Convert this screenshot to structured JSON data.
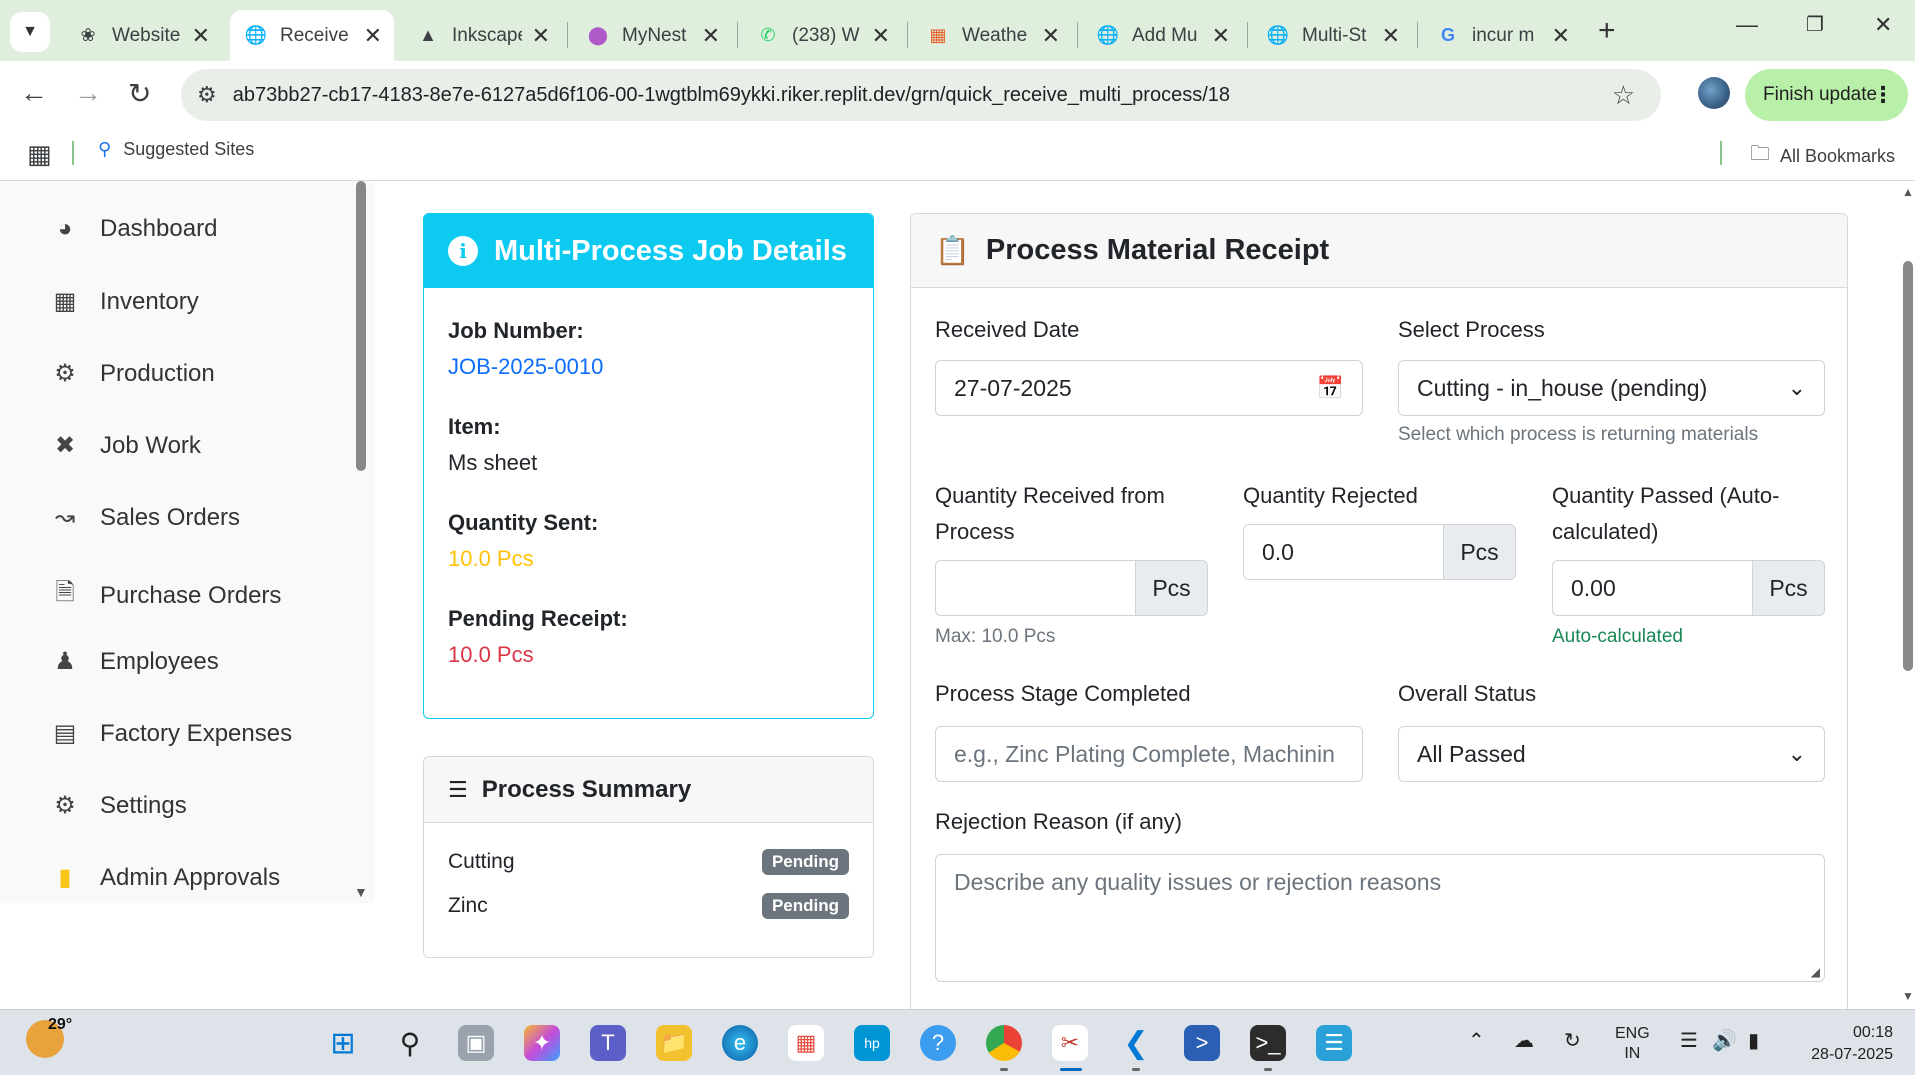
{
  "browser": {
    "tabs": [
      {
        "title": "Website",
        "icon": "openai-icon"
      },
      {
        "title": "Receive",
        "icon": "globe-icon",
        "active": true
      },
      {
        "title": "Inkscape",
        "icon": "inkscape-icon"
      },
      {
        "title": "MyNest",
        "icon": "mynest-icon"
      },
      {
        "title": "(238) W",
        "icon": "whatsapp-icon"
      },
      {
        "title": "Weathe",
        "icon": "weather-icon"
      },
      {
        "title": "Add Mu",
        "icon": "globe-icon"
      },
      {
        "title": "Multi-St",
        "icon": "globe-icon"
      },
      {
        "title": "incur m",
        "icon": "google-icon"
      }
    ],
    "url": "ab73bb27-cb17-4183-8e7e-6127a5d6f106-00-1wgtblm69ykki.riker.replit.dev/grn/quick_receive_multi_process/18",
    "finish_update": "Finish update",
    "bookmarks": {
      "suggested": "Suggested Sites",
      "all": "All Bookmarks"
    }
  },
  "sidebar": {
    "items": [
      {
        "label": "Dashboard",
        "icon": "dashboard-icon"
      },
      {
        "label": "Inventory",
        "icon": "boxes-icon"
      },
      {
        "label": "Production",
        "icon": "cogs-icon"
      },
      {
        "label": "Job Work",
        "icon": "tools-icon"
      },
      {
        "label": "Sales Orders",
        "icon": "chart-line-icon"
      },
      {
        "label": "Purchase Orders",
        "icon": "file-icon"
      },
      {
        "label": "Employees",
        "icon": "users-icon"
      },
      {
        "label": "Factory Expenses",
        "icon": "receipt-icon"
      },
      {
        "label": "Settings",
        "icon": "gear-icon"
      },
      {
        "label": "Admin Approvals",
        "icon": "clipboard-check-icon"
      }
    ]
  },
  "job_details": {
    "title": "Multi-Process Job Details",
    "job_number_label": "Job Number:",
    "job_number": "JOB-2025-0010",
    "item_label": "Item:",
    "item": "Ms sheet",
    "qty_sent_label": "Quantity Sent:",
    "qty_sent": "10.0 Pcs",
    "pending_label": "Pending Receipt:",
    "pending": "10.0 Pcs",
    "colors": {
      "header": "#0dcaf0",
      "link": "#0d6efd",
      "warning": "#ffc107",
      "danger": "#dc3545"
    }
  },
  "process_summary": {
    "title": "Process Summary",
    "rows": [
      {
        "name": "Cutting",
        "status": "Pending"
      },
      {
        "name": "Zinc",
        "status": "Pending"
      }
    ]
  },
  "receipt": {
    "title": "Process Material Receipt",
    "received_date_label": "Received Date",
    "received_date": "27-07-2025",
    "select_process_label": "Select Process",
    "select_process_value": "Cutting - in_house (pending)",
    "select_process_help": "Select which process is returning materials",
    "qty_received_label": "Quantity Received from Process",
    "qty_received_value": "",
    "qty_received_unit": "Pcs",
    "qty_received_help": "Max: 10.0 Pcs",
    "qty_rejected_label": "Quantity Rejected",
    "qty_rejected_value": "0.0",
    "qty_rejected_unit": "Pcs",
    "qty_passed_label": "Quantity Passed (Auto-calculated)",
    "qty_passed_value": "0.00",
    "qty_passed_unit": "Pcs",
    "qty_passed_help": "Auto-calculated",
    "stage_label": "Process Stage Completed",
    "stage_placeholder": "e.g., Zinc Plating Complete, Machinin",
    "overall_status_label": "Overall Status",
    "overall_status_value": "All Passed",
    "rejection_label": "Rejection Reason (if any)",
    "rejection_placeholder": "Describe any quality issues or rejection reasons"
  },
  "taskbar": {
    "temperature": "29°",
    "lang_line1": "ENG",
    "lang_line2": "IN",
    "time": "00:18",
    "date": "28-07-2025"
  }
}
